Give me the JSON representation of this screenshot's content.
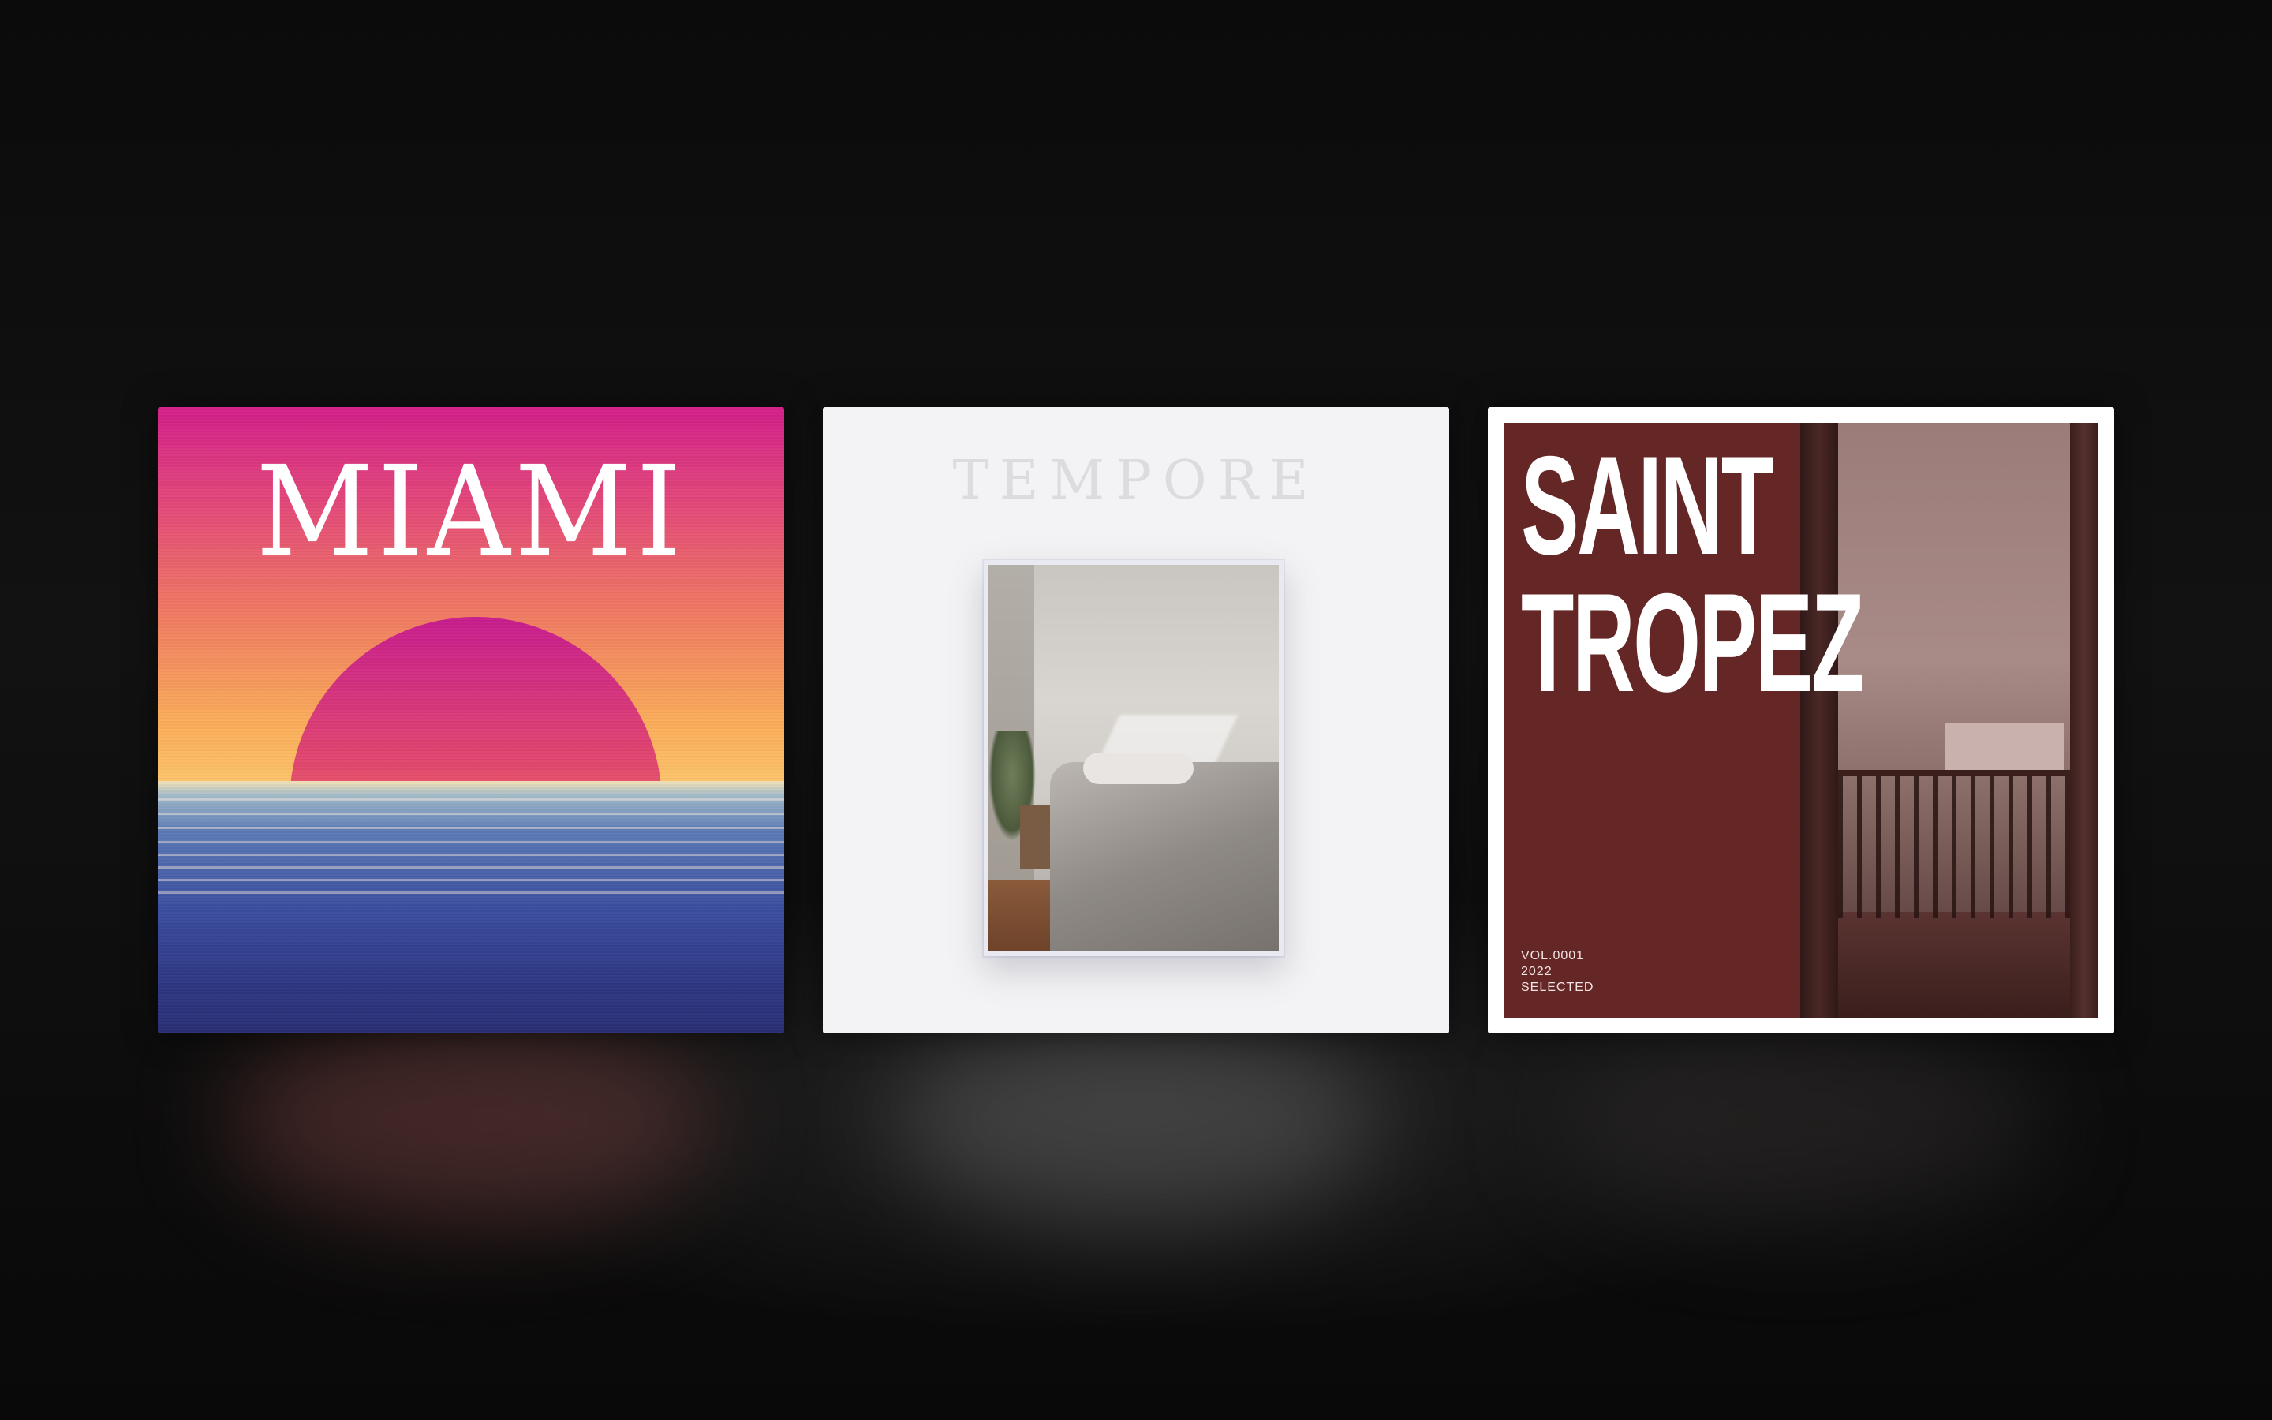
{
  "albums": [
    {
      "id": "miami",
      "title": "MIAMI",
      "colors": {
        "sky_top": "#d21f8a",
        "sky_bottom": "#fcc36a",
        "sea": "#3b4fa0"
      }
    },
    {
      "id": "tempore",
      "title": "TEMPORE",
      "colors": {
        "background": "#f3f3f5",
        "title": "#dcdce0"
      }
    },
    {
      "id": "saint-tropez",
      "title_line1": "SAINT",
      "title_line2": "TROPEZ",
      "meta": [
        "VOL.0001",
        "2022",
        "SELECTED"
      ],
      "colors": {
        "panel": "#652626",
        "frame": "#ffffff"
      }
    }
  ]
}
